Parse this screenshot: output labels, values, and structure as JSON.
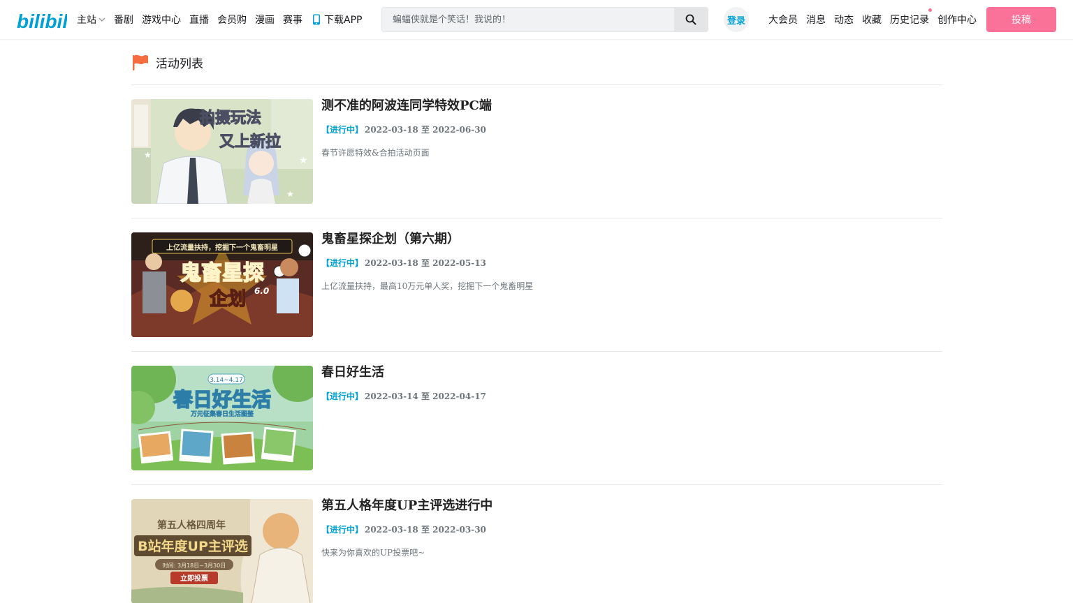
{
  "header": {
    "nav_left": [
      {
        "label": "主站",
        "has_dropdown": true
      },
      {
        "label": "番剧"
      },
      {
        "label": "游戏中心"
      },
      {
        "label": "直播"
      },
      {
        "label": "会员购"
      },
      {
        "label": "漫画"
      },
      {
        "label": "赛事"
      },
      {
        "label": "下载APP",
        "icon": "phone-icon"
      }
    ],
    "search": {
      "placeholder": "蝙蝠侠就是个笑话！我说的！"
    },
    "login_label": "登录",
    "nav_right": [
      {
        "label": "大会员"
      },
      {
        "label": "消息"
      },
      {
        "label": "动态"
      },
      {
        "label": "收藏"
      },
      {
        "label": "历史记录",
        "has_dot": true
      },
      {
        "label": "创作中心"
      }
    ],
    "upload_label": "投稿"
  },
  "page": {
    "title": "活动列表",
    "title_icon": "flag-icon"
  },
  "activities": [
    {
      "title": "测不准的阿波连同学特效PC端",
      "status": "【进行中】",
      "dates": "2022-03-18 至 2022-06-30",
      "description": "春节许愿特效&合拍活动页面",
      "cover_theme": "anime-classroom",
      "cover_text": [
        "拍摄玩法",
        "又上新拉"
      ]
    },
    {
      "title": "鬼畜星探企划（第六期）",
      "status": "【进行中】",
      "dates": "2022-03-18 至 2022-05-13",
      "description": "上亿流量扶持，最高10万元单人奖，挖掘下一个鬼畜明星",
      "cover_theme": "kichiku-scout",
      "cover_text": [
        "上亿流量扶持，挖掘下一个鬼畜明星",
        "鬼畜星探",
        "企划",
        "6.0"
      ]
    },
    {
      "title": "春日好生活",
      "status": "【进行中】",
      "dates": "2022-03-14 至 2022-04-17",
      "description": "",
      "cover_theme": "spring-life",
      "cover_text": [
        "3.14~4.17",
        "春日好生活",
        "万元征集春日生活图鉴"
      ]
    },
    {
      "title": "第五人格年度UP主评选进行中",
      "status": "【进行中】",
      "dates": "2022-03-18 至 2022-03-30",
      "description": "快来为你喜欢的UP投票吧~",
      "cover_theme": "identity-v-award",
      "cover_text": [
        "第五人格四周年",
        "B站年度UP主评选",
        "时间: 3月18日~3月30日",
        "立即投票"
      ]
    }
  ],
  "colors": {
    "accent_blue": "#00a1d6",
    "pink": "#fb7299",
    "flag_orange": "#f56c40",
    "divider": "#e5e9ef",
    "muted_text": "#6d757a"
  }
}
